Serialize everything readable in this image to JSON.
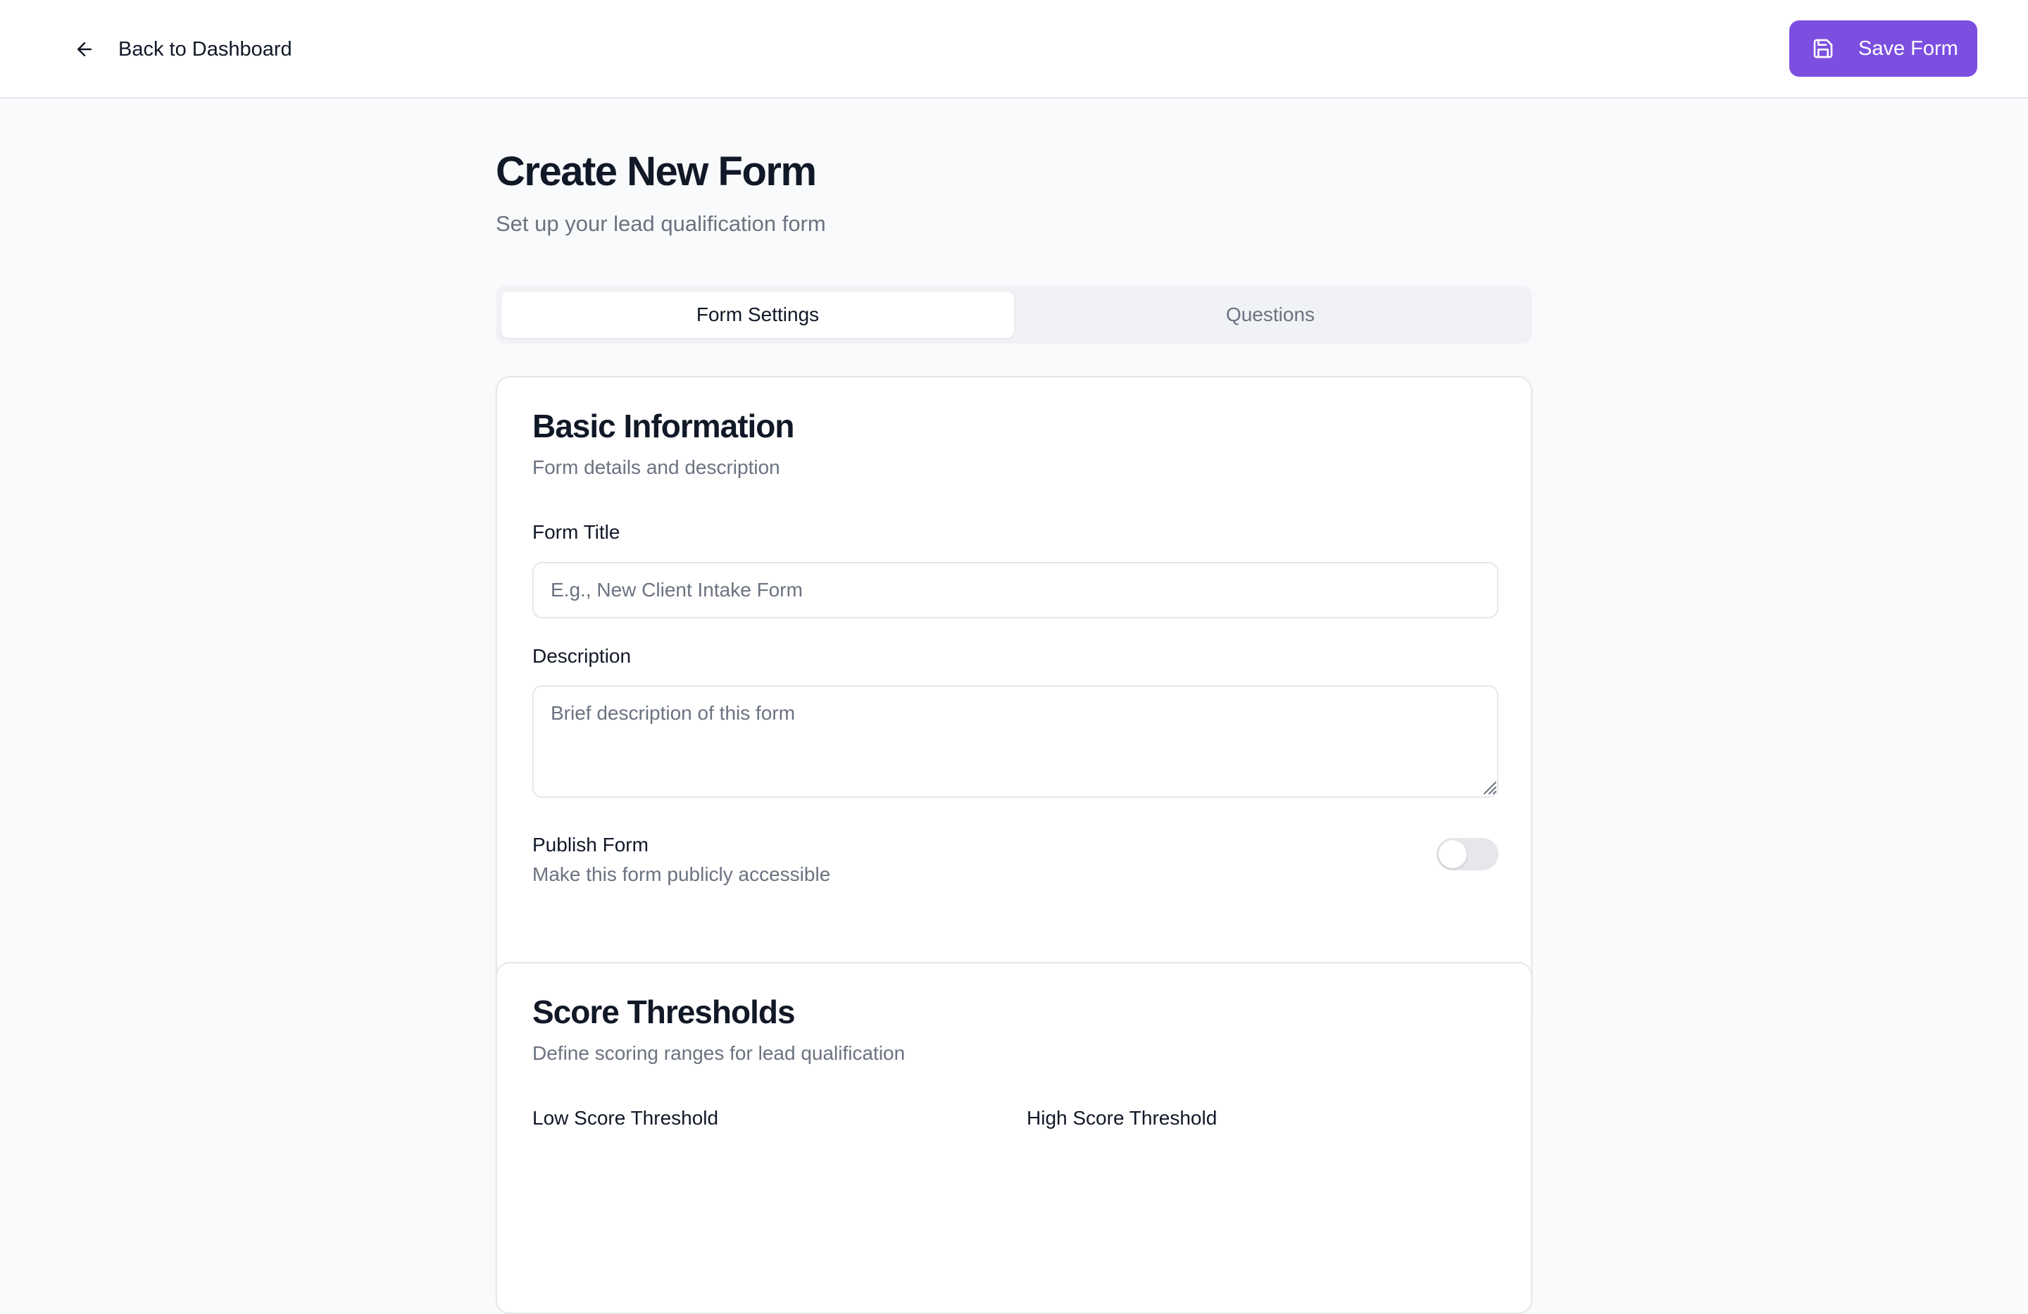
{
  "header": {
    "back_label": "Back to Dashboard",
    "back_icon": "arrow-left-icon",
    "save_label": "Save Form",
    "save_icon": "save-icon"
  },
  "page": {
    "title": "Create New Form",
    "subtitle": "Set up your lead qualification form"
  },
  "tabs": [
    {
      "label": "Form Settings",
      "active": true
    },
    {
      "label": "Questions",
      "active": false
    }
  ],
  "basic_info": {
    "title": "Basic Information",
    "subtitle": "Form details and description",
    "form_title_label": "Form Title",
    "form_title_value": "",
    "form_title_placeholder": "E.g., New Client Intake Form",
    "description_label": "Description",
    "description_value": "",
    "description_placeholder": "Brief description of this form",
    "publish_label": "Publish Form",
    "publish_help": "Make this form publicly accessible",
    "publish_enabled": false
  },
  "score_thresholds": {
    "title": "Score Thresholds",
    "subtitle": "Define scoring ranges for lead qualification",
    "low_label": "Low Score Threshold",
    "high_label": "High Score Threshold"
  },
  "colors": {
    "accent": "#7c4fe0",
    "background": "#f9fafb",
    "muted_text": "#6b7280",
    "border": "#e5e7eb"
  }
}
